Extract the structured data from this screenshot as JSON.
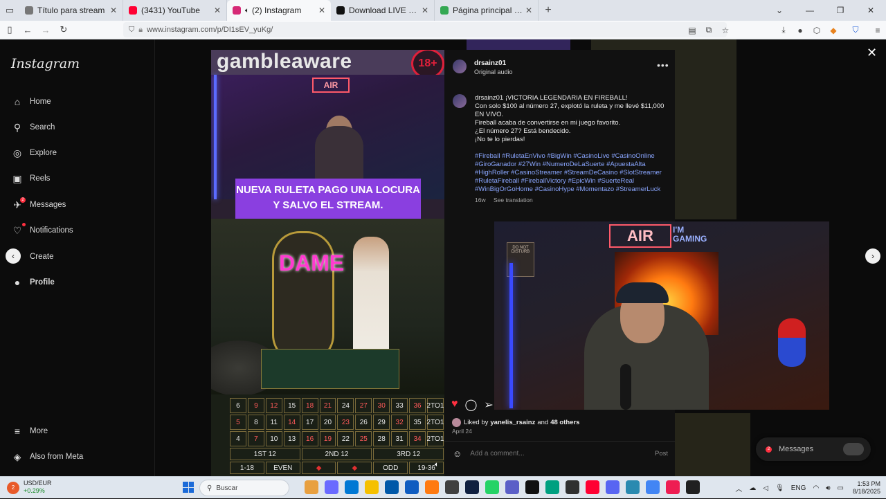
{
  "browser": {
    "tabs": [
      {
        "title": "Título para stream",
        "active": false,
        "favicon_color": "#777777"
      },
      {
        "title": "(3431) YouTube",
        "active": false,
        "favicon_color": "#ff0033"
      },
      {
        "title": "(2) Instagram",
        "active": true,
        "favicon_color": "#d62976",
        "audio": true
      },
      {
        "title": "Download LIVE Studio | TikTok",
        "active": false,
        "favicon_color": "#111111"
      },
      {
        "title": "Página principal - Google Drive",
        "active": false,
        "favicon_color": "#34a853"
      }
    ],
    "new_tab_label": "+",
    "url": "www.instagram.com/p/DI1sEV_yuKg/"
  },
  "sidebar": {
    "logo": "Instagram",
    "items": [
      {
        "label": "Home",
        "icon": "home-icon",
        "glyph": "⌂"
      },
      {
        "label": "Search",
        "icon": "search-icon",
        "glyph": "⚲"
      },
      {
        "label": "Explore",
        "icon": "compass-icon",
        "glyph": "◎"
      },
      {
        "label": "Reels",
        "icon": "reels-icon",
        "glyph": "▣"
      },
      {
        "label": "Messages",
        "icon": "messenger-icon",
        "glyph": "✈",
        "badge": "2"
      },
      {
        "label": "Notifications",
        "icon": "heart-icon",
        "glyph": "♡",
        "dot": true
      },
      {
        "label": "Create",
        "icon": "plus-icon",
        "glyph": "⊕"
      },
      {
        "label": "Profile",
        "icon": "profile-avatar-icon",
        "glyph": "●"
      }
    ],
    "bottom": [
      {
        "label": "More",
        "icon": "menu-icon",
        "glyph": "≡"
      },
      {
        "label": "Also from Meta",
        "icon": "meta-icon",
        "glyph": "◈"
      }
    ]
  },
  "reel": {
    "banner_text": "gambleaware",
    "age_badge": "18+",
    "sign_text": "AIR",
    "caption_overlay": "NUEVA RULETA PAGO UNA LOCURA Y SALVO EL STREAM.",
    "dame_text": "DAME",
    "grid_rows": [
      [
        "6",
        "9",
        "12",
        "15",
        "18",
        "21",
        "24",
        "27",
        "30",
        "33",
        "36",
        "2TO1"
      ],
      [
        "5",
        "8",
        "11",
        "14",
        "17",
        "20",
        "23",
        "26",
        "29",
        "32",
        "35",
        "2TO1"
      ],
      [
        "4",
        "7",
        "10",
        "13",
        "16",
        "19",
        "22",
        "25",
        "28",
        "31",
        "34",
        "2TO1"
      ]
    ],
    "grid_dozens": [
      "1ST 12",
      "2ND 12",
      "3RD 12"
    ],
    "grid_bottom": [
      "1-18",
      "EVEN",
      "◆",
      "◆",
      "ODD",
      "19-36"
    ]
  },
  "post": {
    "username": "drsainz01",
    "audio": "Original audio",
    "caption_lines": [
      "drsainz01 ¡VICTORIA LEGENDARIA EN FIREBALL!",
      "Con solo $100 al número 27, explotó la ruleta y me llevé $11,000 EN VIVO.",
      "Fireball acaba de convertirse en mi juego favorito.",
      "¿El número 27? Está bendecido.",
      "¡No te lo pierdas!"
    ],
    "hashtags": "#Fireball #RuletaEnVivo #BigWin #CasinoLive #CasinoOnline #GiroGanador #27Win #NumeroDeLaSuerte #ApuestaAlta #HighRoller #CasinoStreamer #StreamDeCasino #SlotStreamer #RuletaFireball #FireballVictory #EpicWin #SuerteReal #WinBigOrGoHome #CasinoHype #Momentazo #StreamerLuck",
    "age": "16w",
    "see_translation": "See translation",
    "liked_by_prefix": "Liked by",
    "liked_by_user": "yanelis_rsainz",
    "liked_by_and": "and",
    "liked_by_others": "48 others",
    "date": "April 24",
    "comment_placeholder": "Add a comment...",
    "post_label": "Post"
  },
  "overlay_video": {
    "sign": "AIR",
    "gaming_text": "I'M\nGAMING",
    "door_sign": "DO NOT DISTURB"
  },
  "messages_pill": {
    "label": "Messages",
    "badge": "2"
  },
  "taskbar": {
    "widget_title": "USD/EUR",
    "widget_value": "+0.29%",
    "widget_badge": "2",
    "search_placeholder": "Buscar",
    "apps": [
      {
        "name": "app-1",
        "color": "#e8a040"
      },
      {
        "name": "app-2",
        "color": "#6a6aff"
      },
      {
        "name": "app-3",
        "color": "#0078d4"
      },
      {
        "name": "app-4",
        "color": "#f5c000"
      },
      {
        "name": "app-5",
        "color": "#0058a8"
      },
      {
        "name": "app-6",
        "color": "#0f5cc0"
      },
      {
        "name": "app-7",
        "color": "#ff7a10"
      },
      {
        "name": "app-8",
        "color": "#404040"
      },
      {
        "name": "app-9",
        "color": "#102040"
      },
      {
        "name": "app-10",
        "color": "#25d366"
      },
      {
        "name": "app-11",
        "color": "#5b5fc7"
      },
      {
        "name": "app-12",
        "color": "#111111"
      },
      {
        "name": "app-13",
        "color": "#00a080"
      },
      {
        "name": "app-14",
        "color": "#303030"
      },
      {
        "name": "app-15",
        "color": "#ff0033"
      },
      {
        "name": "app-16",
        "color": "#5865f2"
      },
      {
        "name": "app-17",
        "color": "#2a8ab0"
      },
      {
        "name": "app-18",
        "color": "#4285f4"
      },
      {
        "name": "app-19",
        "color": "#ee1d52"
      },
      {
        "name": "app-20",
        "color": "#202020"
      }
    ],
    "lang": "ENG",
    "time": "1:53 PM",
    "date": "8/18/2025"
  }
}
